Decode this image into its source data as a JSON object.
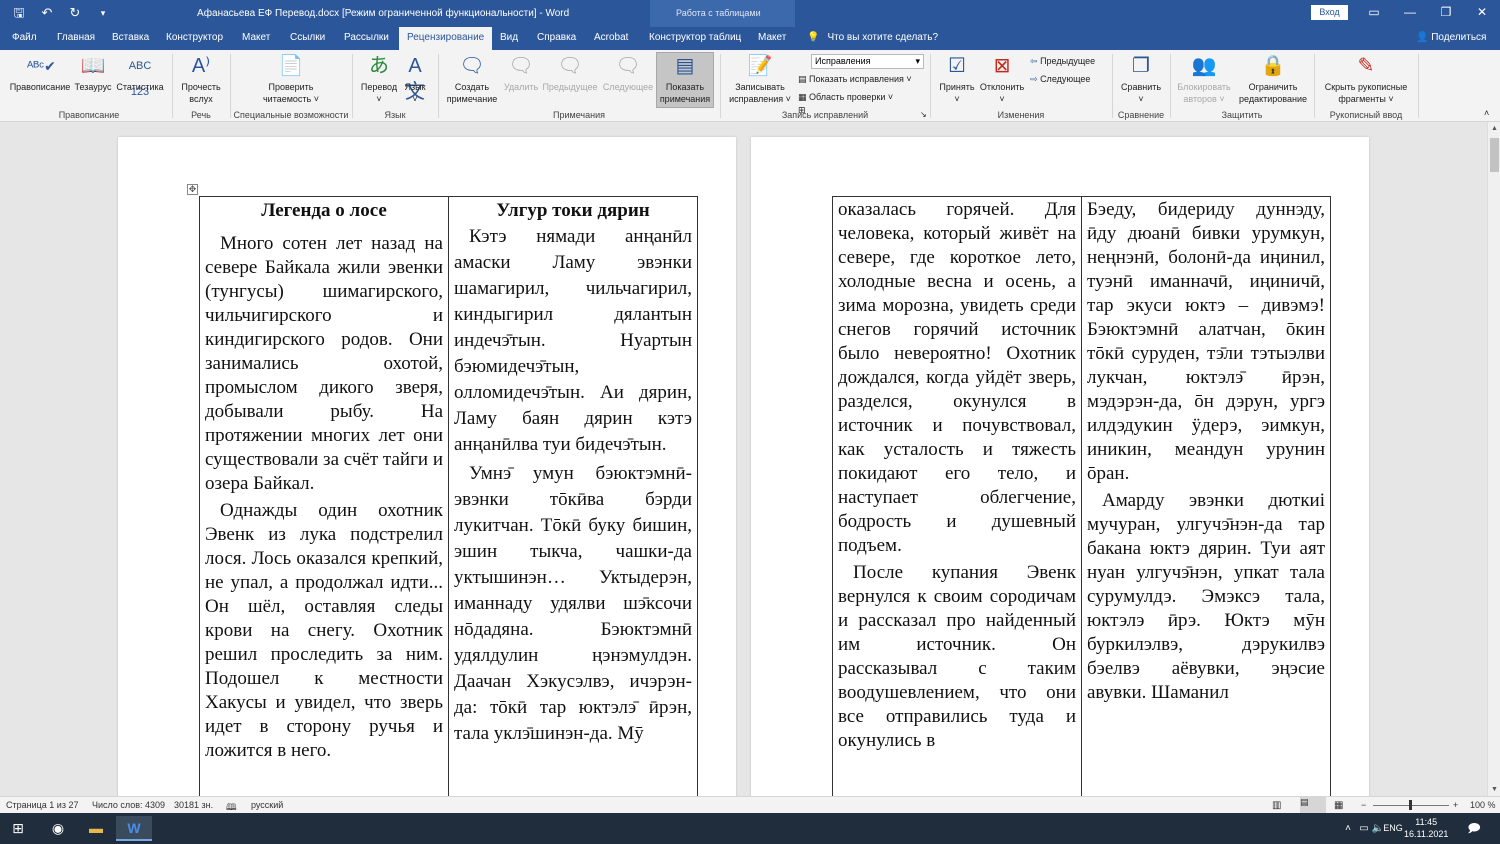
{
  "window": {
    "title": "Афанасьева ЕФ Перевод.docx [Режим ограниченной функциональности] - Word",
    "context_tab_group": "Работа с таблицами",
    "signin": "Вход"
  },
  "tabs": [
    "Файл",
    "Главная",
    "Вставка",
    "Конструктор",
    "Макет",
    "Ссылки",
    "Рассылки",
    "Рецензирование",
    "Вид",
    "Справка",
    "Acrobat",
    "Конструктор таблиц",
    "Макет"
  ],
  "active_tab": "Рецензирование",
  "tell_me": "Что вы хотите сделать?",
  "share": "Поделиться",
  "ribbon": {
    "spelling": "Правописание",
    "thesaurus": "Тезаурус",
    "statistics": "Статистика",
    "read_aloud_1": "Прочесть",
    "read_aloud_2": "вслух",
    "check_access_1": "Проверить",
    "check_access_2": "читаемость ˅",
    "translate": "Перевод",
    "language": "Язык",
    "new_comment_1": "Создать",
    "new_comment_2": "примечание",
    "delete": "Удалить",
    "previous": "Предыдущее",
    "next": "Следующее",
    "show_comments_1": "Показать",
    "show_comments_2": "примечания",
    "track_changes_1": "Записывать",
    "track_changes_2": "исправления ˅",
    "markup_value": "Исправления",
    "show_markup": "Показать исправления ˅",
    "reviewing_pane": "Область проверки ˅",
    "accept": "Принять",
    "reject": "Отклонить",
    "prev_change": "Предыдущее",
    "next_change": "Следующее",
    "compare": "Сравнить",
    "block_authors_1": "Блокировать",
    "block_authors_2": "авторов ˅",
    "restrict_1": "Ограничить",
    "restrict_2": "редактирование",
    "hide_ink_1": "Скрыть рукописные",
    "hide_ink_2": "фрагменты ˅",
    "groups": {
      "proofing": "Правописание",
      "speech": "Речь",
      "accessibility": "Специальные возможности",
      "language": "Язык",
      "comments": "Примечания",
      "tracking": "Запись исправлений",
      "changes": "Изменения",
      "compare": "Сравнение",
      "protect": "Защитить",
      "ink": "Рукописный ввод"
    }
  },
  "page1": {
    "col1_title": "Легенда о лосе",
    "col1_p1": "Много сотен лет назад на севере Байкала жили эвенки (тунгусы) шимагирского, чильчигирского и киндигирского родов. Они занимались охотой, промыслом дикого зверя, добывали рыбу. На протяжении многих лет они существовали за счёт тайги и озера Байкал.",
    "col1_p2": "Однажды один охотник Эвенк из лука подстрелил лося. Лось оказался крепкий, не упал, а продолжал идти... Он шёл, оставляя следы крови на снегу. Охотник решил проследить за ним. Подошел к местности Хакусы и увидел, что зверь идет в сторону ручья и ложится в него.",
    "col2_title": "Улгур токи дярин",
    "col2_p1": "Кэтэ нямади анңанӣл амаски Ламу эвэнки шамагирил, чильчагирил, киндыгирил дялантын индечэ̄тын. Нуартын бэюмидечэ̄тын, олломидечэ̄тын. Аи дярин, Ламу баян дярин кэтэ анңанӣлва туи бидечэ̄тын.",
    "col2_p2": "Умнэ̄ умун бэюктэмнӣ-эвэнки тōкӣва бэрди лукитчан. Тōкӣ буку бишин, эшин тыкча, чашки-да уктышинэн… Уктыдерэн, иманнаду удялви шэ̄ксочи нōдадяна. Бэюктэмнӣ удялдулин ңэнэмулдэн. Даачан Хэкусэлвэ, ичэрэн-да: тōкӣ тар юктэлэ̄ ӣрэн, тала уклэ̄шинэн-да. Мӯ"
  },
  "page2": {
    "col1_p1": "оказалась горячей. Для человека, который живёт на севере, где короткое лето, холодные весна и осень, а зима морозна, увидеть среди снегов горячий источник было невероятно! Охотник дождался, когда уйдёт зверь, разделся, окунулся в источник и почувствовал, как усталость и тяжесть покидают его тело, и наступает облегчение, бодрость и душевный подъем.",
    "col1_p2": "После купания Эвенк вернулся к своим сородичам и рассказал про найденный им источник. Он рассказывал с таким воодушевлением, что они все отправились туда и окунулись в",
    "col2_p1": "Бэеду, бидериду дуннэду, ӣду дюанӣ бивки урумкун, неңнэнӣ, болонӣ-да иңинил, туэнӣ иманначӣ, иңиничӣ, тар экуси юктэ – дивэмэ! Бэюктэмнӣ алатчан, ōкин тōкӣ суруден, тэ̄ли тэтыэлви лукчан, юктэлэ̄ ӣрэн, мэдэрэн-да, ōн дэрун, ургэ илдэдукин ӱдерэ, эимкун, иникин, меандун урунин ōран.",
    "col2_p2": "Амарду эвэнки дюткиi мучуран, улгучэ̄нэн-да тар бакана юктэ дярин. Туи аят нуан улгучэ̄нэн, упкат тала сурумулдэ. Эмэксэ тала, юктэлэ ӣрэ. Юктэ мӯн буркилэлвэ, дэрукилвэ бэелвэ аёвувки, эңэсие авувки. Шаманил"
  },
  "status": {
    "page": "Страница 1 из 27",
    "words": "Число слов: 4309",
    "chars": "30181 зн.",
    "language": "русский",
    "zoom": "100 %"
  },
  "taskbar": {
    "lang": "ENG",
    "time": "11:45",
    "date": "16.11.2021"
  }
}
